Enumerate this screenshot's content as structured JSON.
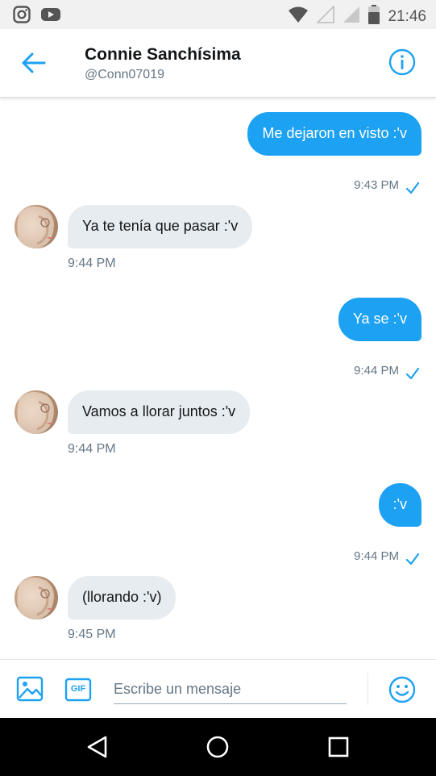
{
  "status_bar": {
    "time": "21:46",
    "left_icons": [
      "instagram-icon",
      "youtube-icon"
    ],
    "right_icons": [
      "wifi-icon",
      "signal-icon",
      "signal-icon",
      "battery-icon"
    ]
  },
  "header": {
    "name": "Connie Sanchísima",
    "handle": "@Conn07019",
    "back_icon": "arrow-left-icon",
    "info_icon": "info-icon",
    "accent": "#1da1f2"
  },
  "messages": [
    {
      "direction": "out",
      "text": "Me dejaron en visto :'v",
      "time": "9:43 PM"
    },
    {
      "direction": "in",
      "text": "Ya te tenía que pasar :'v",
      "time": "9:44 PM"
    },
    {
      "direction": "out",
      "text": "Ya se :'v",
      "time": "9:44 PM"
    },
    {
      "direction": "in",
      "text": "Vamos a llorar juntos :'v",
      "time": "9:44 PM"
    },
    {
      "direction": "out",
      "text": ":'v",
      "time": "9:44 PM"
    },
    {
      "direction": "in",
      "text": "(llorando :'v)",
      "time": "9:45 PM"
    }
  ],
  "compose": {
    "placeholder": "Escribe un mensaje",
    "value": "",
    "gif_label": "GIF",
    "icons": [
      "image-icon",
      "gif-icon",
      "emoji-icon"
    ]
  },
  "colors": {
    "outgoing_bubble": "#1da1f2",
    "incoming_bubble": "#e6ecf0",
    "secondary_text": "#657786"
  },
  "nav_bar": {
    "icons": [
      "back-triangle-icon",
      "home-circle-icon",
      "recents-square-icon"
    ]
  }
}
